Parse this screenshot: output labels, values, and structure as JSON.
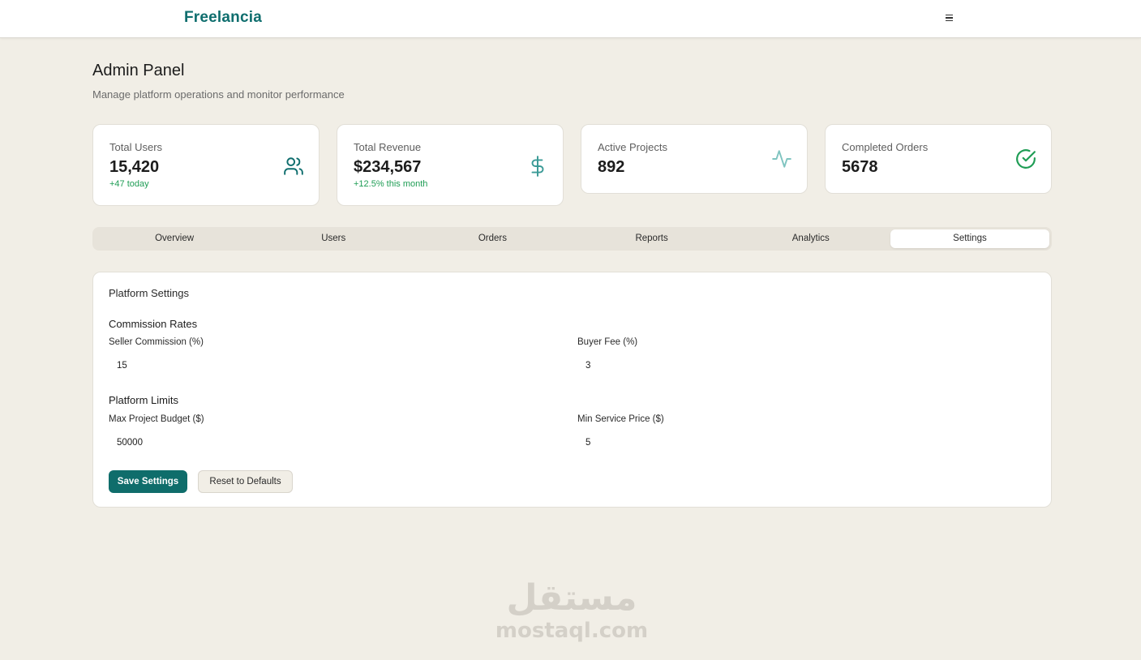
{
  "app": {
    "brand": "Freelancia",
    "menu_icon": "hamburger-menu-icon"
  },
  "header": {
    "title": "Admin Panel",
    "subtitle": "Manage platform operations and monitor performance"
  },
  "stats": [
    {
      "label": "Total Users",
      "value": "15,420",
      "delta": "+47 today",
      "icon": "users-icon",
      "icon_color": "#0f6e6e"
    },
    {
      "label": "Total Revenue",
      "value": "$234,567",
      "delta": "+12.5% this month",
      "icon": "dollar-icon",
      "icon_color": "#3a9a96"
    },
    {
      "label": "Active Projects",
      "value": "892",
      "delta": "",
      "icon": "activity-icon",
      "icon_color": "#7fc4c0"
    },
    {
      "label": "Completed Orders",
      "value": "5678",
      "delta": "",
      "icon": "check-circle-icon",
      "icon_color": "#1f9d55"
    }
  ],
  "tabs": [
    {
      "label": "Overview"
    },
    {
      "label": "Users"
    },
    {
      "label": "Orders"
    },
    {
      "label": "Reports"
    },
    {
      "label": "Analytics"
    },
    {
      "label": "Settings",
      "active": true
    }
  ],
  "settings": {
    "title": "Platform Settings",
    "commission": {
      "title": "Commission Rates",
      "seller_label": "Seller Commission (%)",
      "seller_value": "15",
      "buyer_label": "Buyer Fee (%)",
      "buyer_value": "3"
    },
    "limits": {
      "title": "Platform Limits",
      "max_budget_label": "Max Project Budget ($)",
      "max_budget_value": "50000",
      "min_price_label": "Min Service Price ($)",
      "min_price_value": "5"
    },
    "save_label": "Save Settings",
    "reset_label": "Reset to Defaults"
  },
  "watermark": {
    "arabic": "مستقل",
    "latin": "mostaql.com"
  },
  "colors": {
    "accent": "#0f6e6e",
    "background": "#f1eee6",
    "positive": "#1f9d55"
  }
}
